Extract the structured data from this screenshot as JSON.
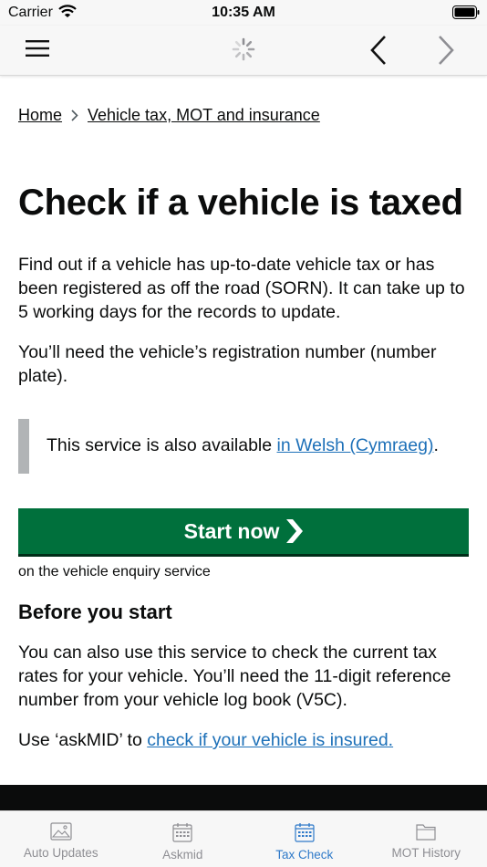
{
  "status_bar": {
    "carrier": "Carrier",
    "time": "10:35 AM"
  },
  "breadcrumb": {
    "home": "Home",
    "section": "Vehicle tax, MOT and insurance"
  },
  "page": {
    "title": "Check if a vehicle is taxed",
    "lead": "Find out if a vehicle has up-to-date vehicle tax or has been registered as off the road (SORN). It can take up to 5 working days for the records to update.",
    "registration_note": "You’ll need the vehicle’s registration number (number plate).",
    "inset_text": "This service is also available ",
    "inset_link": "in Welsh (Cymraeg)",
    "inset_end": ".",
    "start_button": "Start now",
    "enquiry_note": "on the vehicle enquiry service",
    "before_heading": "Before you start",
    "before_text": "You can also use this service to check the current tax rates for your vehicle. You’ll need the 11-digit reference number from your vehicle log book (V5C).",
    "askmid_text": "Use ‘askMID’ to ",
    "askmid_link": "check if your vehicle is insured."
  },
  "tabs": [
    {
      "label": "Auto  Updates",
      "icon": "image-icon",
      "active": false
    },
    {
      "label": "Askmid",
      "icon": "calendar-icon",
      "active": false
    },
    {
      "label": "Tax Check",
      "icon": "calendar-icon",
      "active": true
    },
    {
      "label": "MOT History",
      "icon": "folder-icon",
      "active": false
    }
  ],
  "colors": {
    "start_button": "#00703c",
    "link": "#1d70b8",
    "inset_border": "#b1b4b6",
    "active_tab": "#2f7ac9"
  }
}
